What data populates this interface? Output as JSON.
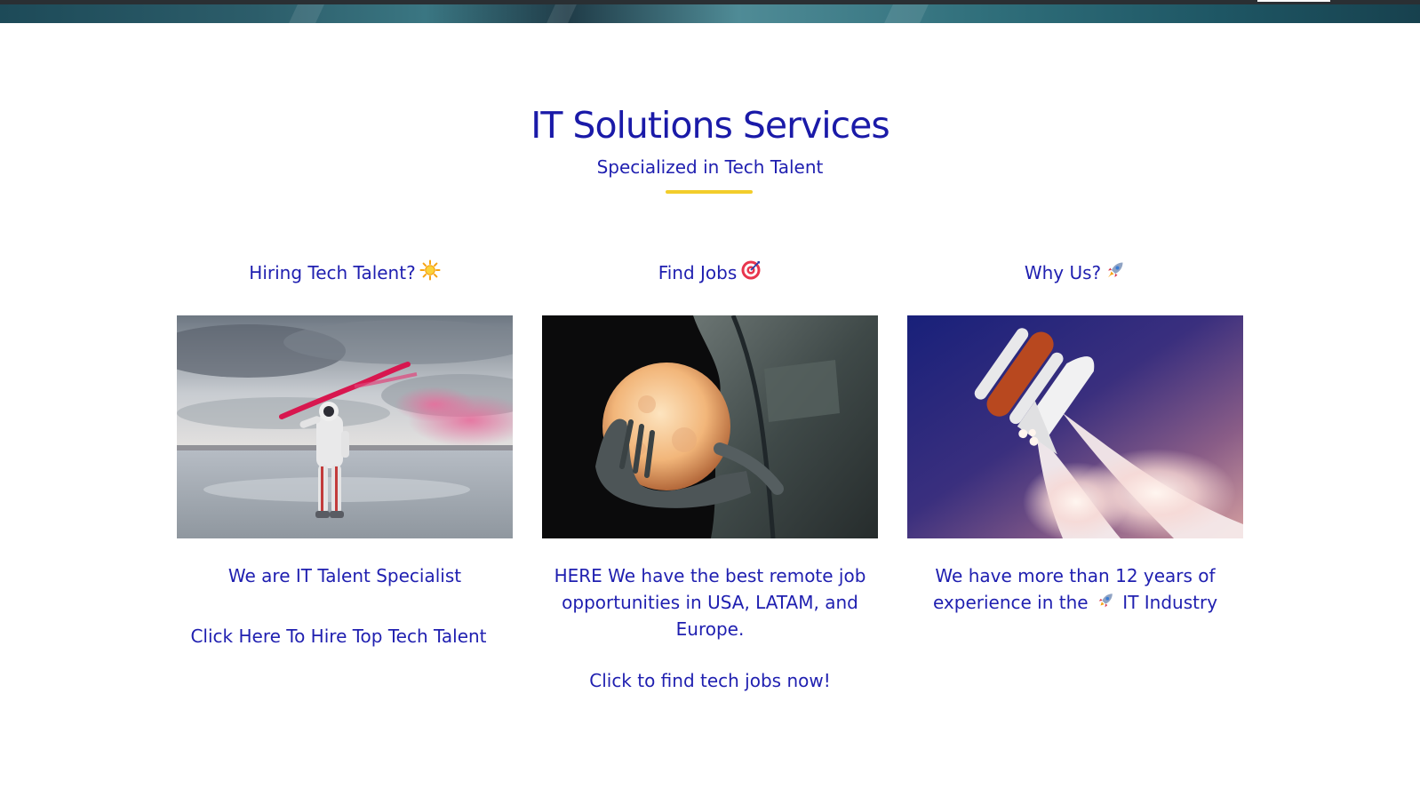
{
  "header": {
    "title": "IT Solutions Services",
    "subtitle": "Specialized in Tech Talent"
  },
  "columns": [
    {
      "heading": "Hiring Tech Talent?",
      "heading_icon": "sun-emoji-icon",
      "image": "astronaut-with-red-smoke-flare-image",
      "description": "We are IT Talent Specialist",
      "link": "Click Here To Hire Top Tech Talent"
    },
    {
      "heading": "Find Jobs",
      "heading_icon": "direct-hit-target-emoji-icon",
      "image": "hands-holding-glowing-moon-lamp-image",
      "description": "HERE We have the best remote job opportunities in USA, LATAM, and Europe.",
      "link": "Click to find tech jobs now!"
    },
    {
      "heading": "Why Us?",
      "heading_icon": "rocket-emoji-icon",
      "image": "space-shuttle-launch-image",
      "description_before": "We have more than 12 years of experience in the",
      "description_icon": "rocket-emoji-icon",
      "description_after": "IT Industry"
    }
  ],
  "colors": {
    "text": "#1f1fb0",
    "accent_divider": "#f2cd2b",
    "background": "#ffffff"
  }
}
